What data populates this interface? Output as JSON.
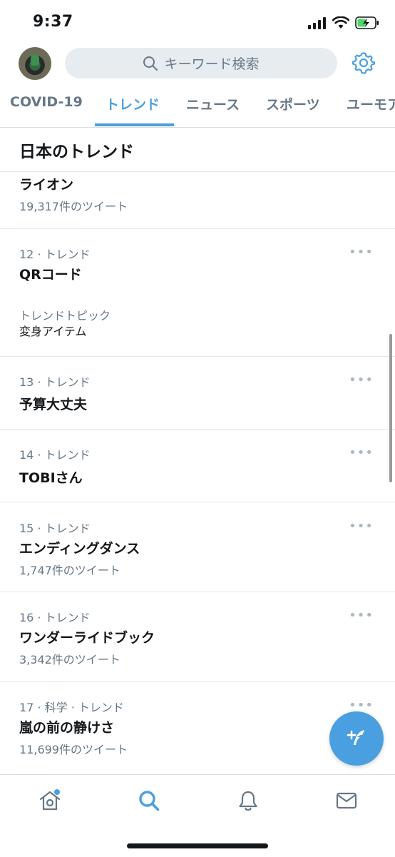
{
  "status_bar": {
    "time": "9:37",
    "icons": [
      "signal-icon",
      "wifi-icon",
      "battery-charging-icon"
    ]
  },
  "header": {
    "search_placeholder": "キーワード検索",
    "icons": [
      "avatar",
      "search-icon",
      "gear-icon"
    ]
  },
  "tabs": [
    {
      "label": "COVID-19",
      "active": false
    },
    {
      "label": "トレンド",
      "active": true
    },
    {
      "label": "ニュース",
      "active": false
    },
    {
      "label": "スポーツ",
      "active": false
    },
    {
      "label": "ユーモア",
      "active": false
    }
  ],
  "section": {
    "title": "日本のトレンド"
  },
  "trends": [
    {
      "name": "ライオン",
      "count": "19,317件のツイート"
    },
    {
      "meta": "12 · トレンド",
      "name": "QRコード",
      "topic_label": "トレンドトピック",
      "topic_value": "変身アイテム"
    },
    {
      "meta": "13 · トレンド",
      "name": "予算大丈夫"
    },
    {
      "meta": "14 · トレンド",
      "name": "TOBIさん"
    },
    {
      "meta": "15 · トレンド",
      "name": "エンディングダンス",
      "count": "1,747件のツイート"
    },
    {
      "meta": "16 · トレンド",
      "name": "ワンダーライドブック",
      "count": "3,342件のツイート"
    },
    {
      "meta": "17 · 科学 · トレンド",
      "name": "嵐の前の静けさ",
      "count": "11,699件のツイート"
    }
  ],
  "more_label": "•••",
  "bottom_nav": [
    "home-icon",
    "search-icon",
    "bell-icon",
    "mail-icon"
  ],
  "colors": {
    "accent": "#4a9fe0",
    "text": "#14171a",
    "secondary": "#657786",
    "divider": "#e1e8ed",
    "search_bg": "#e6ecf0"
  }
}
